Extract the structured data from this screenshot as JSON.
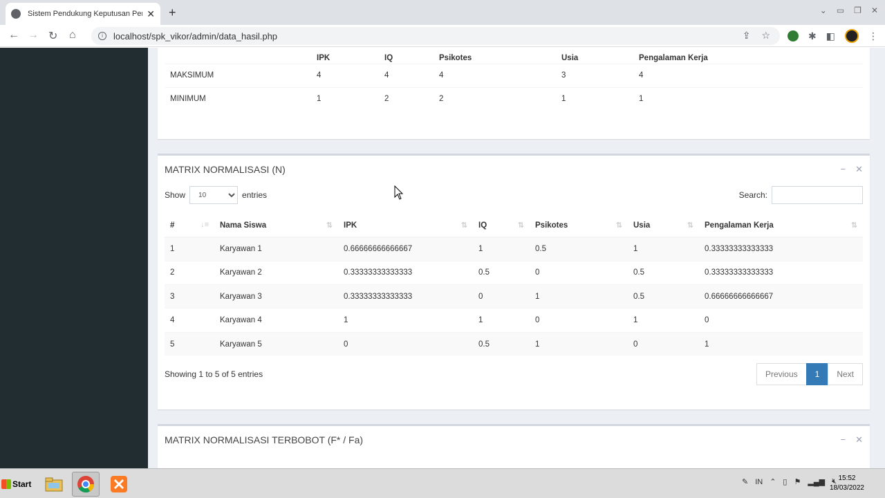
{
  "browser": {
    "tab_title": "Sistem Pendukung Keputusan Pener",
    "tab_close": "✕",
    "new_tab": "+",
    "url": "localhost/spk_vikor/admin/data_hasil.php"
  },
  "top_box": {
    "headers": [
      "IPK",
      "IQ",
      "Psikotes",
      "Usia",
      "Pengalaman Kerja"
    ],
    "rows": [
      {
        "label": "MAKSIMUM",
        "values": [
          "4",
          "4",
          "4",
          "3",
          "4"
        ]
      },
      {
        "label": "MINIMUM",
        "values": [
          "1",
          "2",
          "2",
          "1",
          "1"
        ]
      }
    ]
  },
  "normalisasi": {
    "title": "MATRIX NORMALISASI (N)",
    "show_label": "Show",
    "entries_label": "entries",
    "length_value": "10",
    "search_label": "Search:",
    "columns": [
      "#",
      "Nama Siswa",
      "IPK",
      "IQ",
      "Psikotes",
      "Usia",
      "Pengalaman Kerja"
    ],
    "rows": [
      [
        "1",
        "Karyawan 1",
        "0.66666666666667",
        "1",
        "0.5",
        "1",
        "0.33333333333333"
      ],
      [
        "2",
        "Karyawan 2",
        "0.33333333333333",
        "0.5",
        "0",
        "0.5",
        "0.33333333333333"
      ],
      [
        "3",
        "Karyawan 3",
        "0.33333333333333",
        "0",
        "1",
        "0.5",
        "0.66666666666667"
      ],
      [
        "4",
        "Karyawan 4",
        "1",
        "1",
        "0",
        "1",
        "0"
      ],
      [
        "5",
        "Karyawan 5",
        "0",
        "0.5",
        "1",
        "0",
        "1"
      ]
    ],
    "info": "Showing 1 to 5 of 5 entries",
    "prev": "Previous",
    "page": "1",
    "next": "Next"
  },
  "terbobot": {
    "title": "MATRIX NORMALISASI TERBOBOT (F* / Fa)"
  },
  "box_tools": {
    "minimize": "−",
    "close": "✕"
  },
  "taskbar": {
    "start": "Start",
    "lang": "IN",
    "time": "15:52",
    "date": "18/03/2022"
  }
}
